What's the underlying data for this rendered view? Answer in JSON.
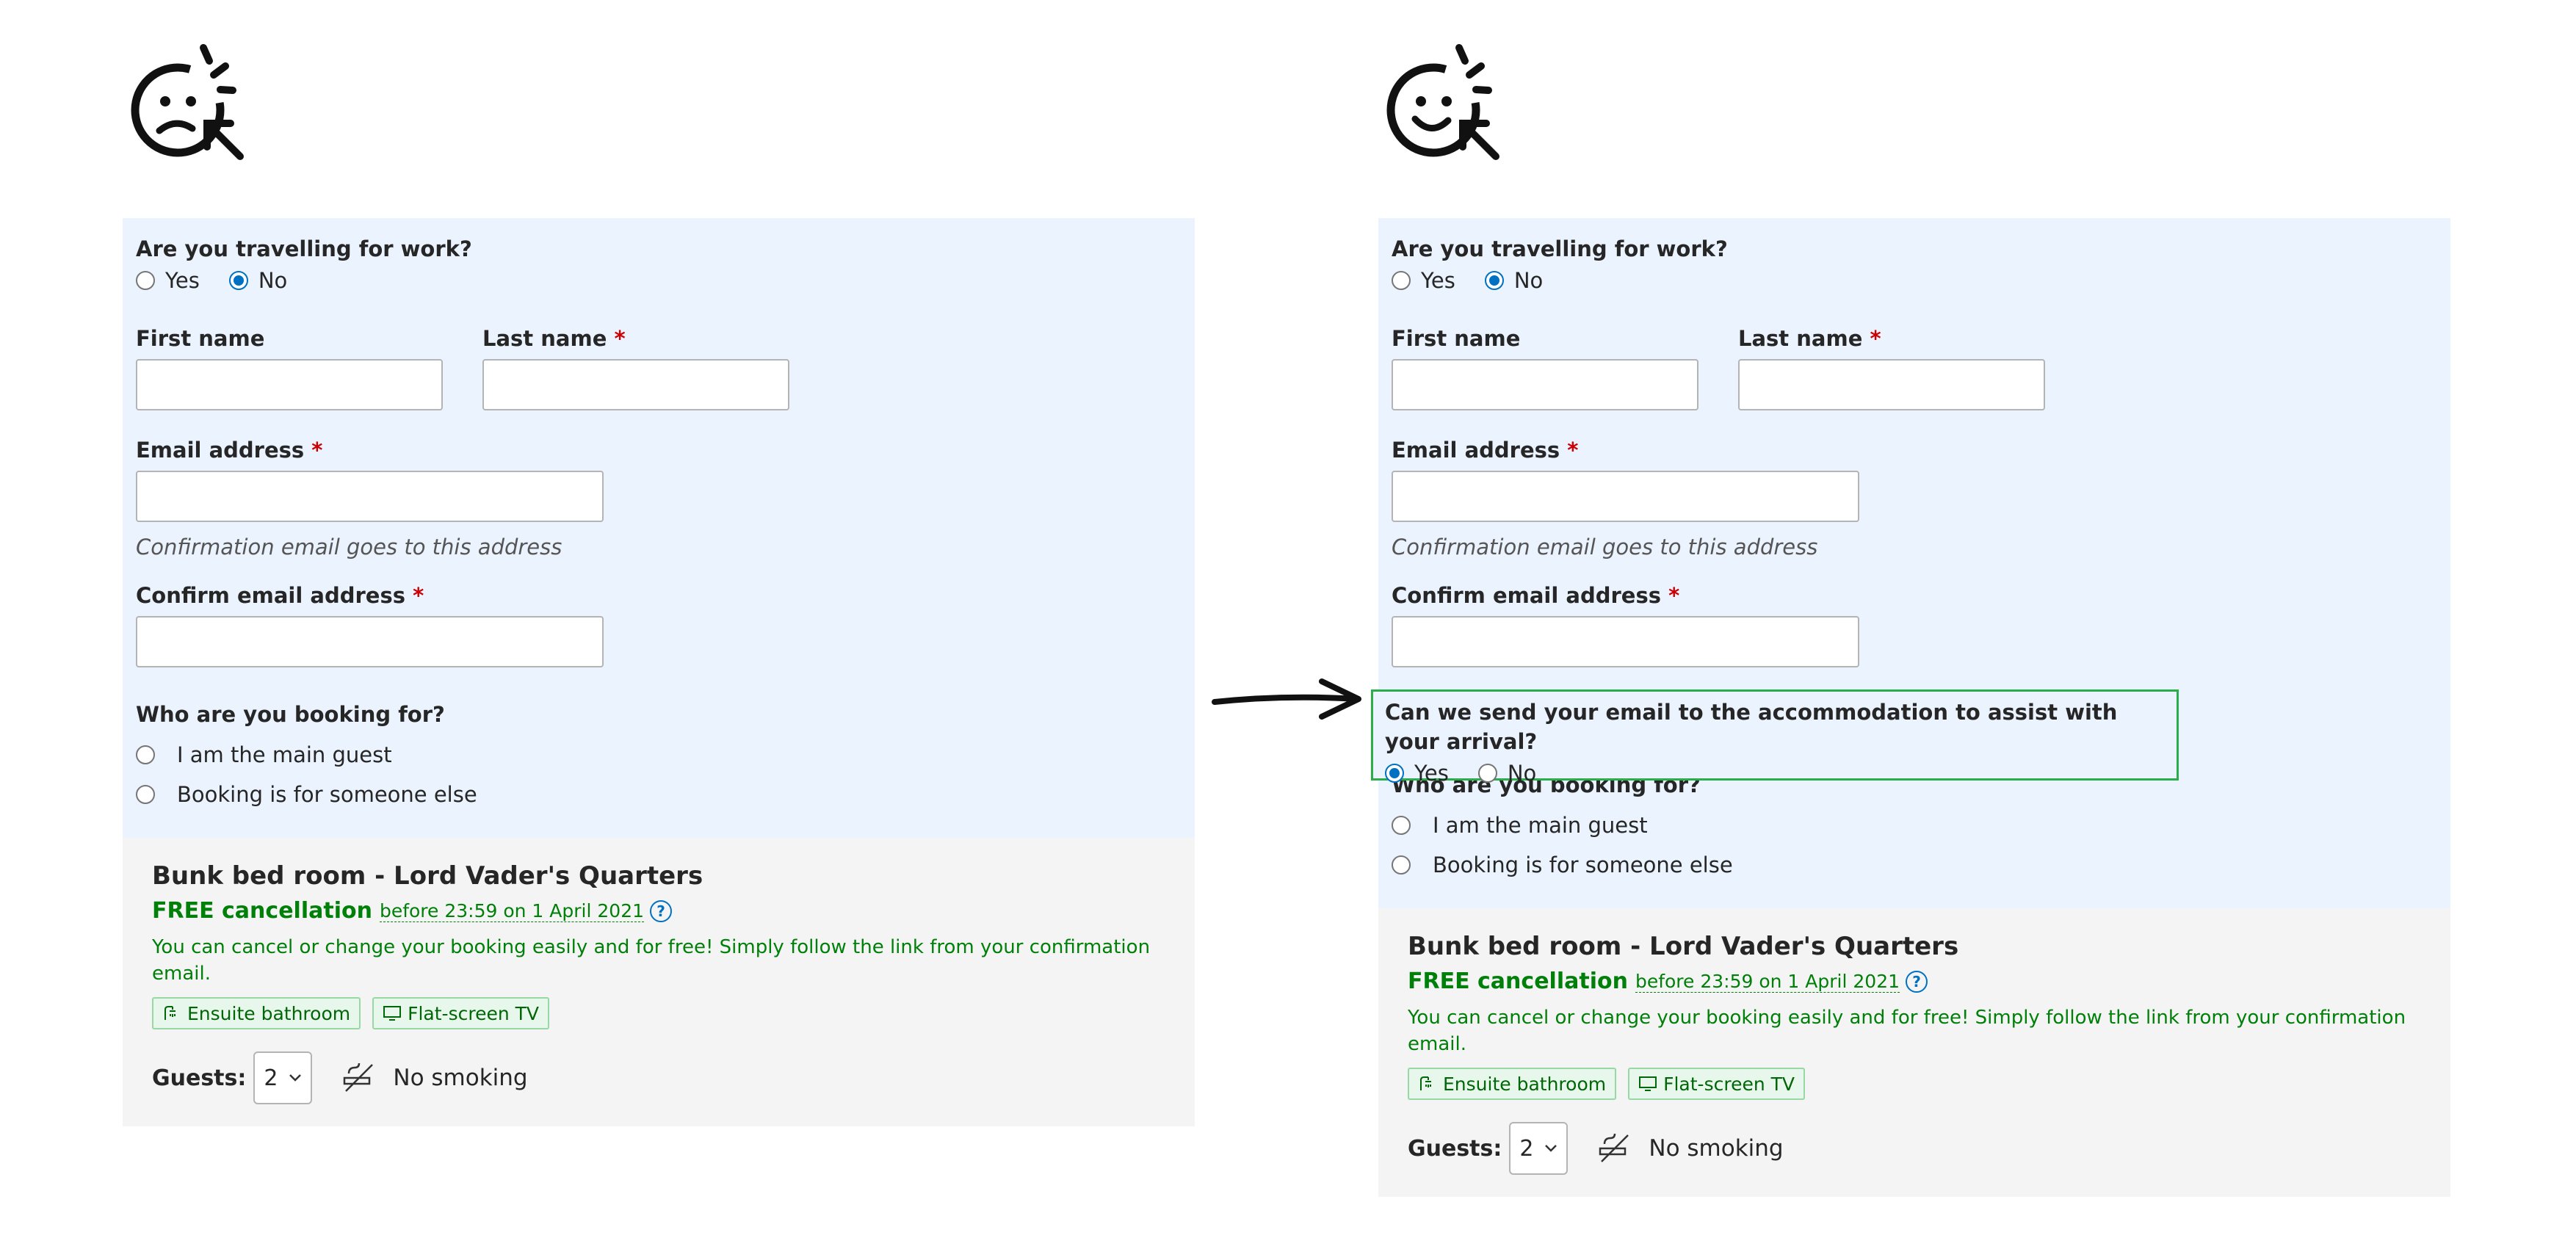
{
  "form": {
    "work_question": "Are you travelling for work?",
    "work_yes": "Yes",
    "work_no": "No",
    "first_name_label": "First name",
    "last_name_label": "Last name",
    "required_mark": "*",
    "email_label": "Email address",
    "email_hint": "Confirmation email goes to this address",
    "confirm_email_label": "Confirm email address",
    "booking_for_question": "Who are you booking for?",
    "main_guest_label": "I am the main guest",
    "someone_else_label": "Booking is for someone else"
  },
  "consent": {
    "question": "Can we send your email to the accommodation to assist with your arrival?",
    "yes_label": "Yes",
    "no_label": "No"
  },
  "room": {
    "title": "Bunk bed room - Lord Vader's Quarters",
    "free_cancellation": "FREE cancellation",
    "cancellation_date": "before 23:59 on 1 April 2021",
    "help_glyph": "?",
    "cancellation_note": "You can cancel or change your booking easily and for free! Simply follow the link from your confirmation email.",
    "amenities": [
      "Ensuite bathroom",
      "Flat-screen TV"
    ],
    "guests_label": "Guests:",
    "guests_value": "2",
    "no_smoking": "No smoking"
  },
  "icons": {
    "left_face": "sad-face-magnifier-icon",
    "right_face": "happy-face-magnifier-icon",
    "arrow": "arrow-right-icon",
    "bathroom": "shower-icon",
    "tv": "tv-icon",
    "no_smoking": "no-smoking-icon",
    "select_chevron": "chevron-down-icon"
  },
  "colors": {
    "form_background": "#ebf3ff",
    "room_background": "#f4f4f4",
    "accent_blue": "#0071c2",
    "success_green": "#008009",
    "highlight_border": "#2bad4a",
    "required_red": "#cc0000"
  }
}
